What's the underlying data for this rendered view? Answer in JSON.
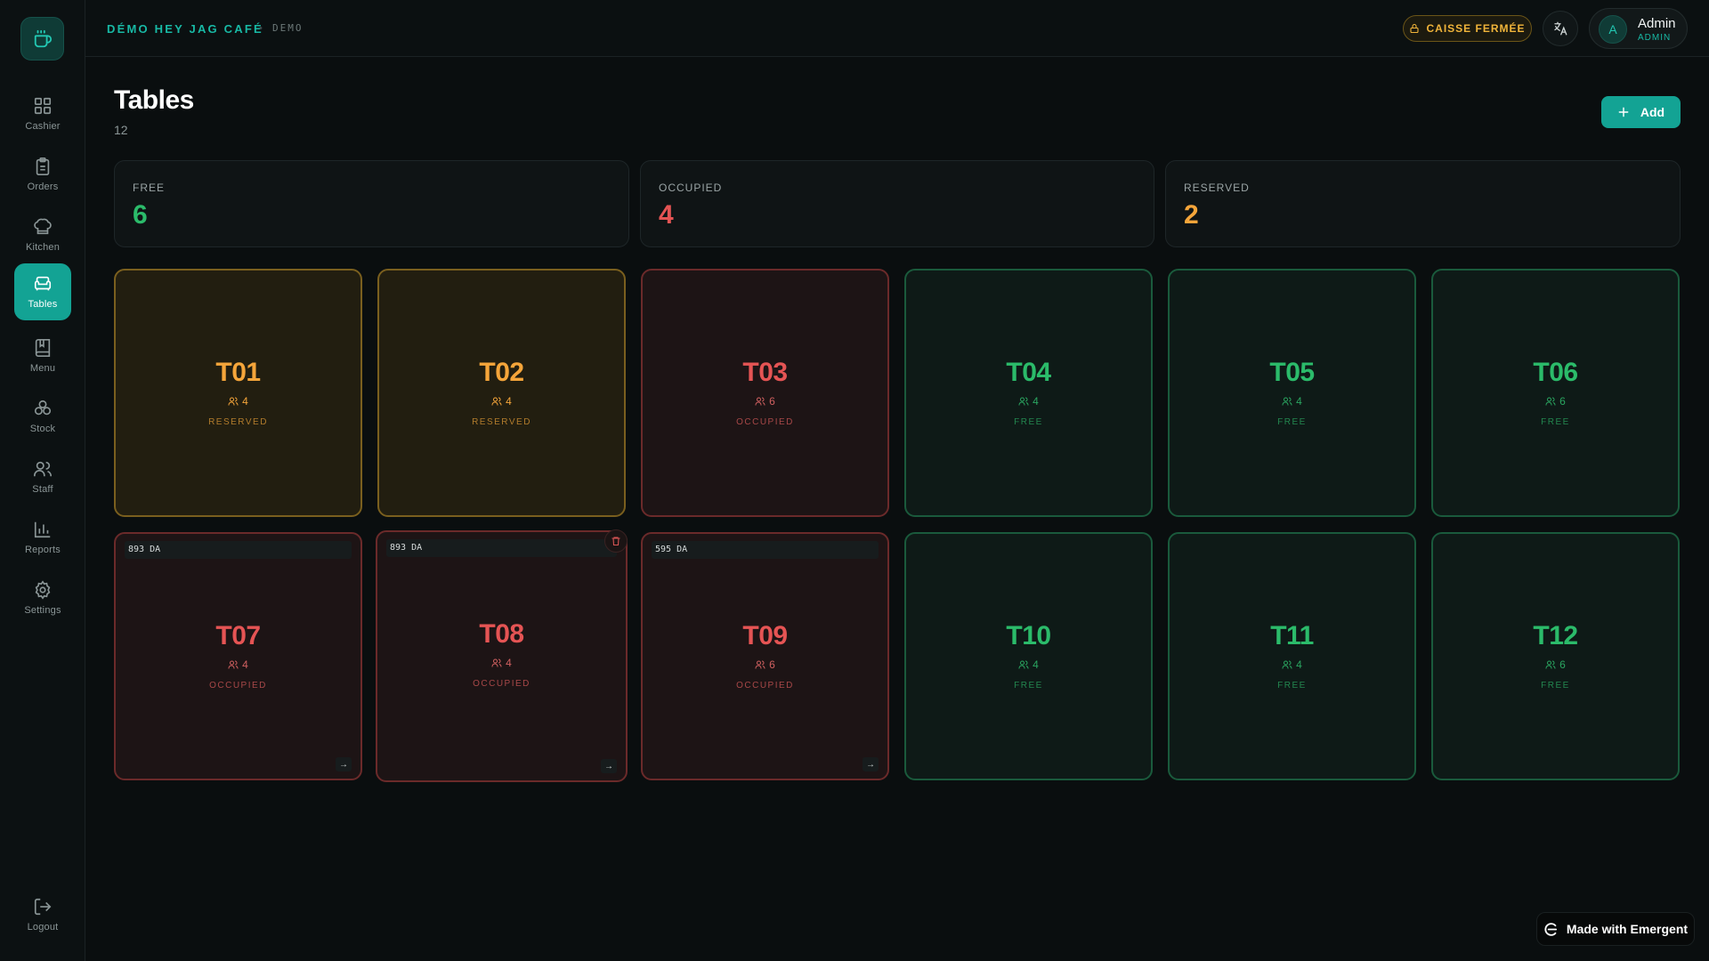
{
  "topbar": {
    "brand": "DÉMO HEY JAG CAFÉ",
    "separator": "•",
    "mode": "DEMO",
    "register_status": "CAISSE FERMÉE",
    "user": {
      "initial": "A",
      "name": "Admin",
      "role": "ADMIN"
    }
  },
  "sidebar": {
    "items": [
      {
        "label": "Cashier",
        "icon": "grid-icon"
      },
      {
        "label": "Orders",
        "icon": "clipboard-icon"
      },
      {
        "label": "Kitchen",
        "icon": "chef-hat-icon"
      },
      {
        "label": "Tables",
        "icon": "armchair-icon",
        "active": true
      },
      {
        "label": "Menu",
        "icon": "book-icon"
      },
      {
        "label": "Stock",
        "icon": "boxes-icon"
      },
      {
        "label": "Staff",
        "icon": "users-icon"
      },
      {
        "label": "Reports",
        "icon": "bar-chart-icon"
      },
      {
        "label": "Settings",
        "icon": "gear-icon"
      }
    ],
    "logout": "Logout"
  },
  "page": {
    "title": "Tables",
    "count": "12",
    "add_label": "Add"
  },
  "stats": [
    {
      "label": "FREE",
      "value": "6",
      "color": "#2bbb6a"
    },
    {
      "label": "OCCUPIED",
      "value": "4",
      "color": "#e55454"
    },
    {
      "label": "RESERVED",
      "value": "2",
      "color": "#f5a53a"
    }
  ],
  "tables": [
    {
      "name": "T01",
      "seats": "4",
      "status": "RESERVED",
      "kind": "reserved"
    },
    {
      "name": "T02",
      "seats": "4",
      "status": "RESERVED",
      "kind": "reserved"
    },
    {
      "name": "T03",
      "seats": "6",
      "status": "OCCUPIED",
      "kind": "occupied"
    },
    {
      "name": "T04",
      "seats": "4",
      "status": "FREE",
      "kind": "free"
    },
    {
      "name": "T05",
      "seats": "4",
      "status": "FREE",
      "kind": "free"
    },
    {
      "name": "T06",
      "seats": "6",
      "status": "FREE",
      "kind": "free"
    },
    {
      "name": "T07",
      "seats": "4",
      "status": "OCCUPIED",
      "kind": "occupied",
      "amount": "893 DA"
    },
    {
      "name": "T08",
      "seats": "4",
      "status": "OCCUPIED",
      "kind": "occupied",
      "amount": "893 DA",
      "hovered": true
    },
    {
      "name": "T09",
      "seats": "6",
      "status": "OCCUPIED",
      "kind": "occupied",
      "amount": "595 DA"
    },
    {
      "name": "T10",
      "seats": "4",
      "status": "FREE",
      "kind": "free"
    },
    {
      "name": "T11",
      "seats": "4",
      "status": "FREE",
      "kind": "free"
    },
    {
      "name": "T12",
      "seats": "6",
      "status": "FREE",
      "kind": "free"
    }
  ],
  "badge": {
    "label": "Made with Emergent"
  }
}
